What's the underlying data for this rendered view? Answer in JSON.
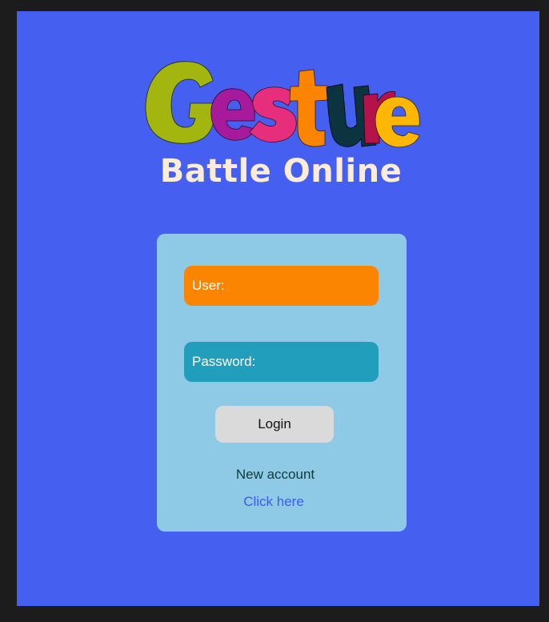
{
  "app": {
    "logo_word": "Gesture",
    "subtitle": "Battle Online"
  },
  "login_form": {
    "user_label": "User:",
    "user_value": "",
    "password_label": "Password:",
    "password_value": "",
    "login_button": "Login",
    "new_account_text": "New account",
    "new_account_link": "Click here"
  },
  "colors": {
    "background": "#4560f0",
    "card": "#8ecae6",
    "user_field": "#fb8500",
    "password_field": "#219ebc",
    "button": "#dadada",
    "link": "#3d5bf2",
    "subtitle": "#fcecd8",
    "logo_letters": [
      "#a3b60f",
      "#a61a9b",
      "#e62e7c",
      "#fb8500",
      "#0b3440",
      "#b3124a",
      "#ffb703"
    ]
  }
}
